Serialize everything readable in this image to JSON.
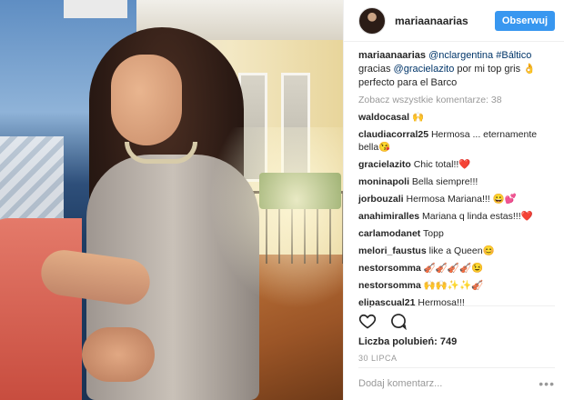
{
  "post": {
    "username": "mariaanaarias",
    "follow_label": "Obserwuj"
  },
  "caption": {
    "username": "mariaanaarias",
    "mention_1": "@nclargentina",
    "hashtag": "#Báltico",
    "text_1": "gracias",
    "mention_2": "@gracielazito",
    "text_2": "por mi top gris 👌 perfecto para el Barco"
  },
  "view_all_comments": "Zobacz wszystkie komentarze: 38",
  "comments": [
    {
      "user": "waldocasal",
      "text": "🙌"
    },
    {
      "user": "claudiacorral25",
      "text": "Hermosa ... eternamente bella😘"
    },
    {
      "user": "gracielazito",
      "text": "Chic total!!❤️"
    },
    {
      "user": "moninapoli",
      "text": "Bella siempre!!!"
    },
    {
      "user": "jorbouzali",
      "text": "Hermosa Mariana!!! 😀💕"
    },
    {
      "user": "anahimiralles",
      "text": "Mariana q linda estas!!!❤️"
    },
    {
      "user": "carlamodanet",
      "text": "Topp"
    },
    {
      "user": "melori_faustus",
      "text": "like a Queen😊"
    },
    {
      "user": "nestorsomma",
      "text": "🎻🎻🎻🎻😉"
    },
    {
      "user": "nestorsomma",
      "text": "🙌🙌✨✨🎻"
    },
    {
      "user": "elipascual21",
      "text": "Hermosa!!!"
    }
  ],
  "likes_label": "Liczba polubień: 749",
  "date": "30 LIPCA",
  "add_comment_placeholder": "Dodaj komentarz...",
  "icons": {
    "like": "heart-icon",
    "comment": "speech-bubble-icon",
    "more": "ellipsis-icon"
  },
  "colors": {
    "follow_button": "#3897f0",
    "link": "#003569",
    "muted": "#999999"
  }
}
